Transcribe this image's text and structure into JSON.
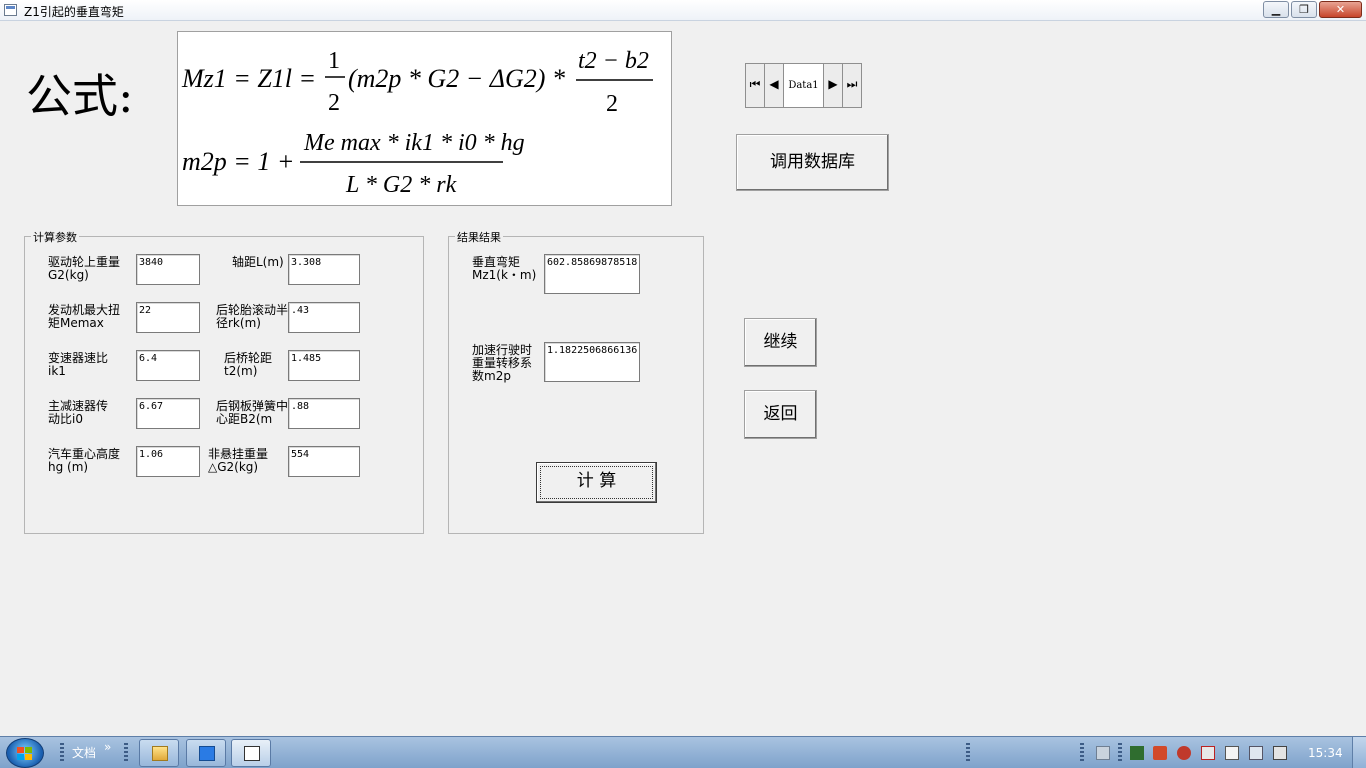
{
  "window": {
    "title": "Z1引起的垂直弯矩",
    "minimize_glyph": "▁",
    "restore_glyph": "❐",
    "close_glyph": "✕"
  },
  "formula": {
    "label": "公式:",
    "line1": {
      "lhs": "Mz1 = Z1l =",
      "coef_num": "1",
      "coef_den": "2",
      "middle": "(m2p * G2 − ΔG2) *",
      "frac_num": "t2 − b2",
      "frac_den": "2"
    },
    "line2": {
      "lhs": "m2p = 1 +",
      "frac_num": "Me max * ik1 * i0 * hg",
      "frac_den": "L * G2 * rk"
    }
  },
  "navigator": {
    "caption": "Data1",
    "first_glyph": "⏮",
    "prev_glyph": "◀",
    "next_glyph": "▶",
    "last_glyph": "⏭"
  },
  "buttons": {
    "database": "调用数据库",
    "continue": "继续",
    "back": "返回",
    "calculate": "计  算"
  },
  "params": {
    "legend": "计算参数",
    "items": [
      {
        "label": "驱动轮上重量G2(kg)",
        "value": "3840"
      },
      {
        "label": "轴距L(m)",
        "value": "3.308"
      },
      {
        "label": "发动机最大扭矩Memax",
        "value": "22"
      },
      {
        "label": "后轮胎滚动半径rk(m)",
        "value": ".43"
      },
      {
        "label": "变速器速比ik1",
        "value": "6.4"
      },
      {
        "label": "后桥轮距t2(m)",
        "value": "1.485"
      },
      {
        "label": "主减速器传动比i0",
        "value": "6.67"
      },
      {
        "label": "后钢板弹簧中心距B2(m",
        "value": ".88"
      },
      {
        "label": "汽车重心高度hg (m)",
        "value": "1.06"
      },
      {
        "label": "非悬挂重量△G2(kg)",
        "value": "554"
      }
    ]
  },
  "results": {
    "legend": "结果结果",
    "items": [
      {
        "label": "垂直弯矩Mz1(k・m)",
        "value": "602.85869878518"
      },
      {
        "label": "加速行驶时重量转移系数m2p",
        "value": "1.1822506866136"
      }
    ]
  },
  "taskbar": {
    "toolbar_label": "文档",
    "chevron": "»",
    "clock": "15:34"
  }
}
